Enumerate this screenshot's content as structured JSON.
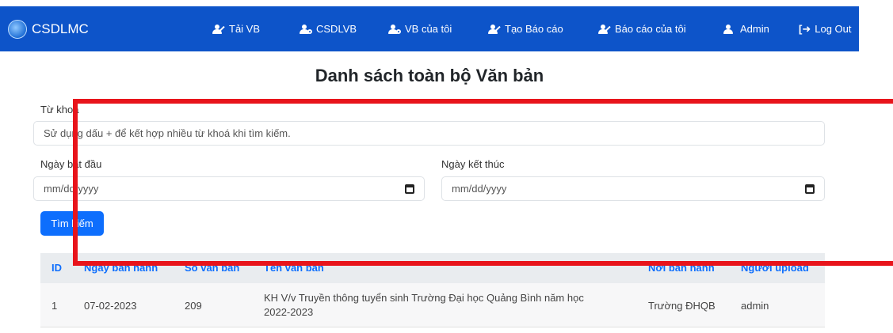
{
  "nav": {
    "brand": "CSDLMC",
    "items": [
      {
        "label": "Tải VB",
        "icon": "user-edit-icon"
      },
      {
        "label": "CSDLVB",
        "icon": "user-cog-icon"
      },
      {
        "label": "VB của tôi",
        "icon": "user-cog-icon"
      },
      {
        "label": "Tạo Báo cáo",
        "icon": "user-edit-icon"
      },
      {
        "label": "Báo cáo của tôi",
        "icon": "user-edit-icon"
      },
      {
        "label": "Admin",
        "icon": "user-icon"
      },
      {
        "label": "Log Out",
        "icon": "sign-out-icon"
      }
    ]
  },
  "page": {
    "title": "Danh sách toàn bộ Văn bản"
  },
  "search": {
    "keyword_label": "Từ khoá",
    "keyword_placeholder": "Sử dụng dấu + để kết hợp nhiều từ khoá khi tìm kiếm.",
    "start_label": "Ngày bắt đầu",
    "end_label": "Ngày kết thúc",
    "date_placeholder": "mm/dd/yyyy",
    "button": "Tìm kiếm"
  },
  "table": {
    "headers": [
      "ID",
      "Ngày ban hành",
      "Số văn bản",
      "Tên văn bản",
      "Nơi ban hành",
      "Người upload"
    ],
    "rows": [
      {
        "id": "1",
        "date": "07-02-2023",
        "number": "209",
        "name_line1": "KH V/v Truyền thông tuyển sinh Trường Đại học Quảng Bình năm học",
        "name_line2": "2022-2023",
        "issuer": "Trường ĐHQB",
        "uploader": "admin"
      }
    ]
  },
  "colors": {
    "navbar": "#0d54c9",
    "accent": "#0d6efd",
    "highlight": "#e8141b"
  }
}
